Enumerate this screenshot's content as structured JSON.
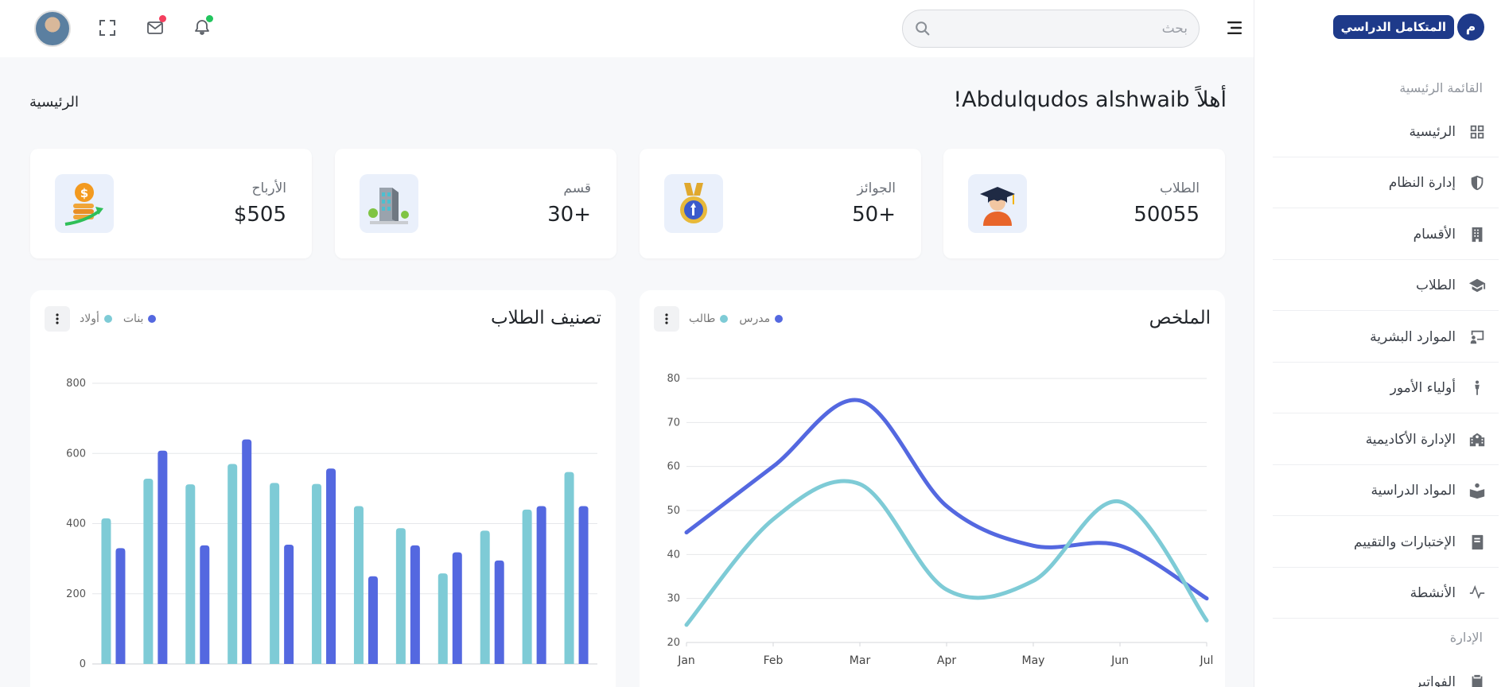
{
  "brand": {
    "logo_letter": "م",
    "name": "المتكامل الدراسي",
    "color": "#1e3a8a"
  },
  "sidebar": {
    "section_main": "القائمة الرئيسية",
    "items": [
      {
        "label": "الرئيسية",
        "icon": "grid-icon"
      },
      {
        "label": "إدارة النظام",
        "icon": "shield-icon"
      },
      {
        "label": "الأقسام",
        "icon": "building-icon"
      },
      {
        "label": "الطلاب",
        "icon": "graduation-cap-icon"
      },
      {
        "label": "الموارد البشرية",
        "icon": "teacher-board-icon"
      },
      {
        "label": "أولياء الأمور",
        "icon": "person-icon"
      },
      {
        "label": "الإدارة الأكاديمية",
        "icon": "school-icon"
      },
      {
        "label": "المواد الدراسية",
        "icon": "book-open-icon"
      },
      {
        "label": "الإختبارات والتقييم",
        "icon": "notebook-icon"
      },
      {
        "label": "الأنشطة",
        "icon": "activity-icon"
      }
    ],
    "section_admin": "الإدارة",
    "admin_items": [
      {
        "label": "الفواتير",
        "icon": "clipboard-icon"
      }
    ]
  },
  "topbar": {
    "search_placeholder": "بحث",
    "notification_dot_color": "#22c55e",
    "mail_dot_color": "#f43f5e"
  },
  "welcome": "أهلاً Abdulqudos alshwaib!",
  "breadcrumb": "الرئيسية",
  "stats": [
    {
      "label": "الطلاب",
      "value": "50055",
      "icon": "student-graduate-icon"
    },
    {
      "label": "الجوائز",
      "value": "50+",
      "icon": "medal-icon"
    },
    {
      "label": "قسم",
      "value": "30+",
      "icon": "building-3d-icon"
    },
    {
      "label": "الأرباح",
      "value": "$505",
      "icon": "coins-growth-icon"
    }
  ],
  "summary_chart": {
    "title": "الملخص",
    "legend": [
      {
        "label": "مدرس",
        "color": "#5468e0"
      },
      {
        "label": "طالب",
        "color": "#7ecbd6"
      }
    ]
  },
  "students_chart": {
    "title": "تصنيف الطلاب",
    "legend": [
      {
        "label": "بنات",
        "color": "#5468e0"
      },
      {
        "label": "أولاد",
        "color": "#7ecbd6"
      }
    ]
  },
  "chart_data": [
    {
      "type": "line",
      "title": "الملخص",
      "x": [
        "Jan",
        "Feb",
        "Mar",
        "Apr",
        "May",
        "Jun",
        "Jul"
      ],
      "series": [
        {
          "name": "مدرس",
          "color": "#5468e0",
          "values": [
            45,
            60,
            75,
            51,
            42,
            42,
            30
          ]
        },
        {
          "name": "طالب",
          "color": "#7ecbd6",
          "values": [
            24,
            48,
            56,
            32,
            34,
            52,
            25
          ]
        }
      ],
      "ylim": [
        20,
        80
      ],
      "yticks": [
        20,
        30,
        40,
        50,
        60,
        70,
        80
      ],
      "grid": true,
      "legend": "top-left"
    },
    {
      "type": "bar",
      "title": "تصنيف الطلاب",
      "categories": [
        "",
        "",
        "",
        "",
        "",
        "",
        "",
        "",
        "",
        "",
        "",
        ""
      ],
      "series": [
        {
          "name": "أولاد",
          "color": "#7ecbd6",
          "values": [
            415,
            528,
            512,
            570,
            516,
            513,
            450,
            387,
            258,
            380,
            440,
            547
          ]
        },
        {
          "name": "بنات",
          "color": "#5468e0",
          "values": [
            330,
            608,
            338,
            640,
            340,
            557,
            250,
            338,
            318,
            295,
            450,
            450
          ]
        }
      ],
      "ylim": [
        0,
        800
      ],
      "yticks": [
        0,
        200,
        400,
        600,
        800
      ],
      "grid": true,
      "legend": "top-left"
    }
  ]
}
